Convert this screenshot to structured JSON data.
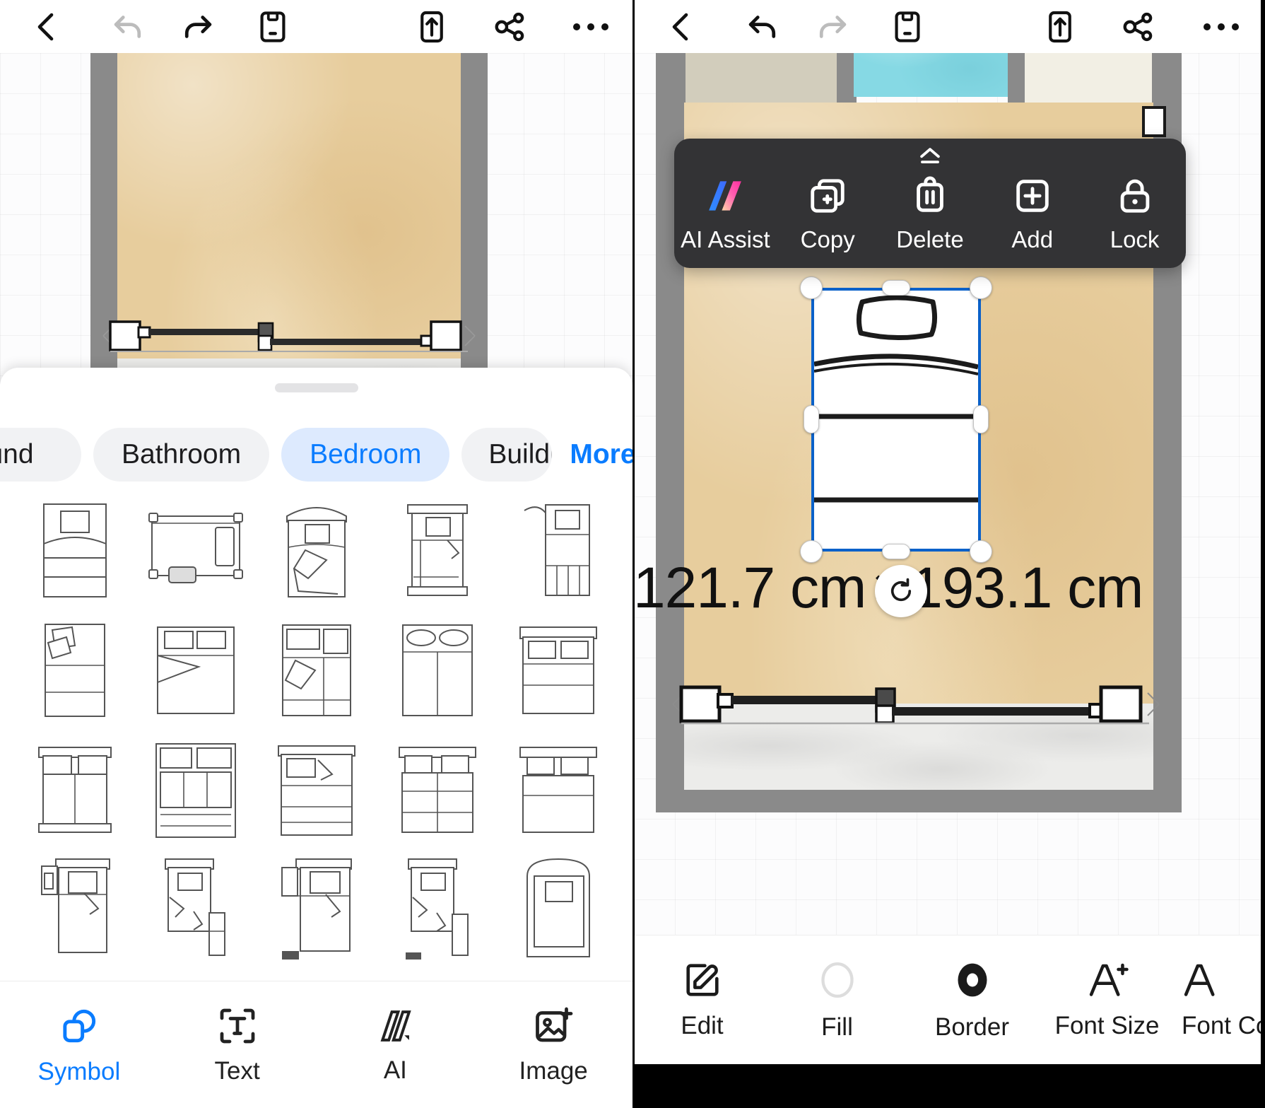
{
  "app": {
    "unit": "cm"
  },
  "left": {
    "toolbar": {
      "back": "back-arrow",
      "undo": "undo-arrow",
      "redo": "redo-arrow",
      "save": "save-disk",
      "export": "export-up",
      "share": "share-nodes",
      "more": "more-dots"
    },
    "sheet": {
      "tabs": [
        {
          "label": "und",
          "selected": false,
          "truncated": true
        },
        {
          "label": "Bathroom",
          "selected": false,
          "truncated": false
        },
        {
          "label": "Bedroom",
          "selected": true,
          "truncated": false
        },
        {
          "label": "Buildi",
          "selected": false,
          "truncated": true
        }
      ],
      "more_label": "More",
      "symbols": [
        "single-bed-plain",
        "bed-side-table",
        "bed-round-headboard",
        "bed-frame-tall",
        "bed-blanket-fold",
        "bed-pillows-angled",
        "double-bed-duvet",
        "bed-nightstand-pair",
        "double-bed-two-pillows",
        "double-bed-headboard",
        "twin-beds-headboard",
        "double-bed-panel",
        "double-bed-fold",
        "twin-beds-pair",
        "double-bed-wide",
        "bed-lamp-left",
        "bed-lamp-desk",
        "bed-lamp-dual",
        "bed-desk-chair",
        "bed-arched-head"
      ]
    },
    "bottom_nav": [
      {
        "label": "Symbol",
        "icon": "symbol-shapes-icon",
        "active": true
      },
      {
        "label": "Text",
        "icon": "text-box-icon",
        "active": false
      },
      {
        "label": "AI",
        "icon": "ai-sparkle-icon",
        "active": false
      },
      {
        "label": "Image",
        "icon": "image-plus-icon",
        "active": false
      }
    ]
  },
  "right": {
    "toolbar": {
      "back": "back-arrow",
      "undo": "undo-arrow",
      "redo": "redo-arrow",
      "save": "save-disk",
      "export": "export-up",
      "share": "share-nodes",
      "more": "more-dots"
    },
    "context_menu": {
      "collapse": "collapse-chevron",
      "items": [
        {
          "label": "AI Assist",
          "icon": "ai-assist-gradient-icon"
        },
        {
          "label": "Copy",
          "icon": "copy-icon"
        },
        {
          "label": "Delete",
          "icon": "trash-icon"
        },
        {
          "label": "Add",
          "icon": "plus-square-icon"
        },
        {
          "label": "Lock",
          "icon": "lock-icon"
        }
      ]
    },
    "selection": {
      "width_label": "121.7 cm",
      "separator": "×",
      "height_label": "193.1 cm",
      "rotate_icon": "rotate-icon",
      "accent": "#0b61c9"
    },
    "bottom_bar": [
      {
        "label": "Edit",
        "icon": "edit-pencil-icon"
      },
      {
        "label": "Fill",
        "icon": "fill-circle-icon"
      },
      {
        "label": "Border",
        "icon": "border-ring-icon"
      },
      {
        "label": "Font Size",
        "icon": "font-size-icon"
      },
      {
        "label": "Font Co",
        "icon": "font-color-icon"
      }
    ]
  }
}
